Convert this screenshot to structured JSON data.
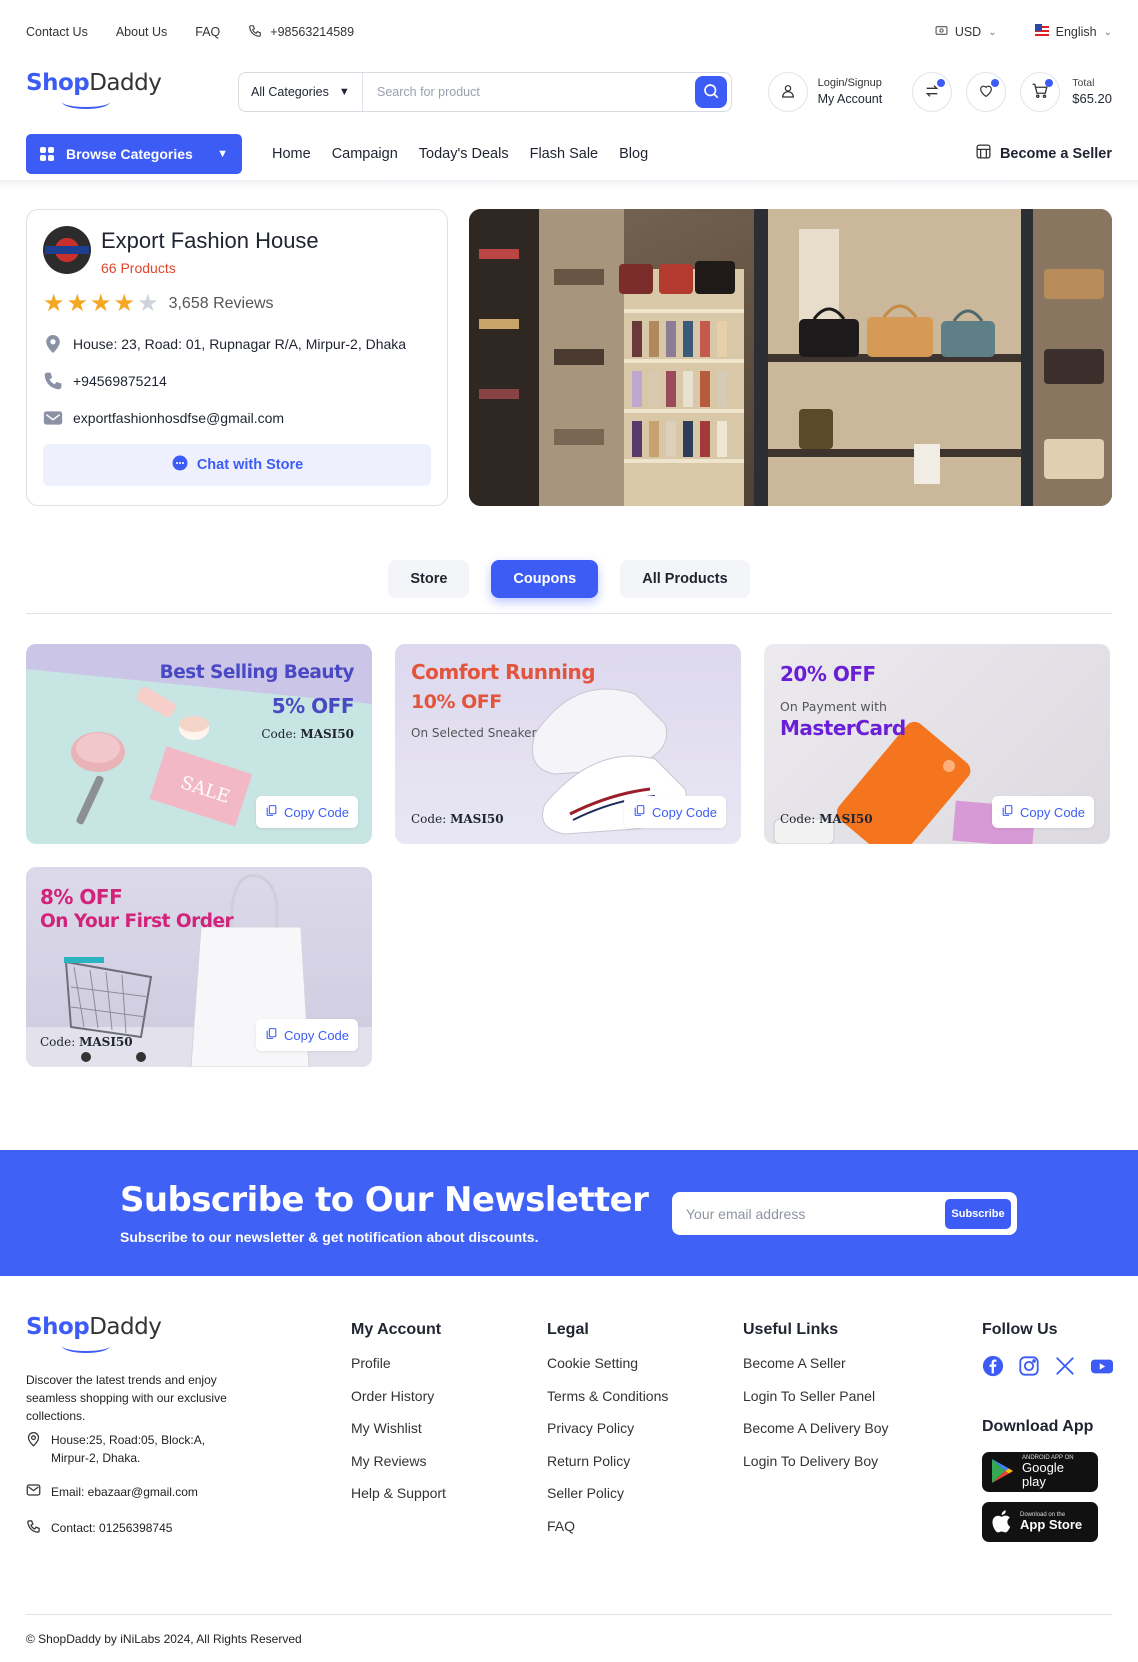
{
  "topbar": {
    "links": [
      "Contact Us",
      "About Us",
      "FAQ"
    ],
    "phone": "+98563214589",
    "currency": "USD",
    "language": "English"
  },
  "header": {
    "logo_shop": "Shop",
    "logo_daddy": "Daddy",
    "category": "All Categories",
    "search_placeholder": "Search for product",
    "login_label": "Login/Signup",
    "account_label": "My Account",
    "total_label": "Total",
    "total_value": "$65.20"
  },
  "nav": {
    "browse": "Browse Categories",
    "items": [
      "Home",
      "Campaign",
      "Today's Deals",
      "Flash Sale",
      "Blog"
    ],
    "seller": "Become a Seller"
  },
  "store": {
    "name": "Export Fashion House",
    "products": "66 Products",
    "rating": 4,
    "rating_max": 5,
    "reviews": "3,658 Reviews",
    "address": "House: 23, Road: 01, Rupnagar R/A, Mirpur-2, Dhaka",
    "phone": "+94569875214",
    "email": "exportfashionhosdfse@gmail.com",
    "chat": "Chat with Store"
  },
  "tabs": [
    "Store",
    "Coupons",
    "All Products"
  ],
  "coupons": [
    {
      "line1": "Best Selling Beauty",
      "line2": "5% OFF",
      "code_label": "Code:",
      "code": "MASI50",
      "button": "Copy Code"
    },
    {
      "line1": "Comfort Running",
      "line2": "10% OFF",
      "line3": "On Selected Sneaker",
      "code_label": "Code:",
      "code": "MASI50",
      "button": "Copy Code"
    },
    {
      "line1": "20% OFF",
      "line2": "On Payment with",
      "line3": "MasterCard",
      "code_label": "Code:",
      "code": "MASI50",
      "button": "Copy Code"
    },
    {
      "line1": "8% OFF",
      "line2": "On Your First Order",
      "code_label": "Code:",
      "code": "MASI50",
      "button": "Copy Code"
    }
  ],
  "newsletter": {
    "title": "Subscribe to Our Newsletter",
    "subtitle": "Subscribe to our newsletter & get notification about discounts.",
    "placeholder": "Your email address",
    "button": "Subscribe"
  },
  "footer": {
    "description": "Discover the latest trends and enjoy seamless shopping with our exclusive collections.",
    "address": "House:25, Road:05, Block:A, Mirpur-2, Dhaka.",
    "email": "Email: ebazaar@gmail.com",
    "contact": "Contact: 01256398745",
    "my_account": {
      "title": "My Account",
      "links": [
        "Profile",
        "Order History",
        "My Wishlist",
        "My Reviews",
        "Help & Support"
      ]
    },
    "legal": {
      "title": "Legal",
      "links": [
        "Cookie Setting",
        "Terms & Conditions",
        "Privacy Policy",
        "Return Policy",
        "Seller Policy",
        "FAQ"
      ]
    },
    "useful": {
      "title": "Useful Links",
      "links": [
        "Become A Seller",
        "Login To Seller Panel",
        "Become A Delivery Boy",
        "Login To Delivery Boy"
      ]
    },
    "follow_title": "Follow Us",
    "social_icons": [
      "facebook-icon",
      "instagram-icon",
      "x-icon",
      "youtube-icon"
    ],
    "download_title": "Download App",
    "google_small": "ANDROID APP ON",
    "google_big": "Google play",
    "apple_small": "Download on the",
    "apple_big": "App Store",
    "copyright": "© ShopDaddy by iNiLabs 2024, All Rights Reserved"
  },
  "colors": {
    "accent": "#3d5cf5",
    "star": "#f5a623",
    "product_count": "#e0452b"
  }
}
